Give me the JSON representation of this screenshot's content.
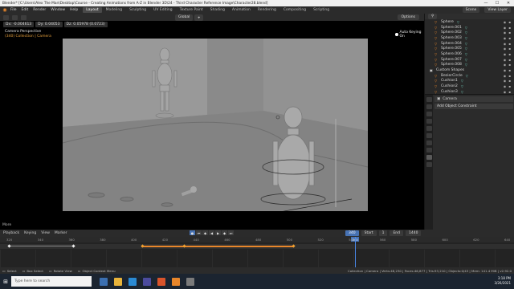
{
  "titlebar": {
    "title": "Blender* [C:\\Users\\Alex The Man\\Desktop\\Course - Creating Animations from A-Z in Blender 3D\\24 - Third Character Reference Image\\Character28.blend]",
    "minimize": "—",
    "maximize": "☐",
    "close": "✕"
  },
  "menubar": {
    "menus": [
      "File",
      "Edit",
      "Render",
      "Window",
      "Help"
    ],
    "workspaces": [
      "Layout",
      "Modeling",
      "Sculpting",
      "UV Editing",
      "Texture Paint",
      "Shading",
      "Animation",
      "Rendering",
      "Compositing",
      "Scripting"
    ],
    "active_workspace": "Layout",
    "scene": "Scene",
    "view_layer": "View Layer"
  },
  "viewport_header": {
    "orientation": "Global",
    "options": "Options"
  },
  "viewport": {
    "coords": [
      "Dx: -0.004613",
      "Dy: 0.04053",
      "Dz: 0.05978 (0.0723)"
    ],
    "info_line1": "Camera Perspective",
    "info_line2": "(340) Collection | Camera",
    "auto_keying": "Auto Keying On",
    "more": "More"
  },
  "outliner": {
    "rows": [
      {
        "label": "Sphere",
        "collection": false
      },
      {
        "label": "Sphere.001",
        "collection": false
      },
      {
        "label": "Sphere.002",
        "collection": false
      },
      {
        "label": "Sphere.003",
        "collection": false
      },
      {
        "label": "Sphere.004",
        "collection": false
      },
      {
        "label": "Sphere.005",
        "collection": false
      },
      {
        "label": "Sphere.006",
        "collection": false
      },
      {
        "label": "Sphere.007",
        "collection": false
      },
      {
        "label": "Sphere.008",
        "collection": false
      },
      {
        "label": "Custom Shapes",
        "collection": true
      },
      {
        "label": "BezierCircle",
        "collection": false
      },
      {
        "label": "Cushion1",
        "collection": false
      },
      {
        "label": "Cushion2",
        "collection": false
      },
      {
        "label": "Cushion3",
        "collection": false
      }
    ]
  },
  "properties": {
    "object": "Camera",
    "add_constraint": "Add Object Constraint"
  },
  "timeline": {
    "menus": [
      "Playback",
      "Keying",
      "View",
      "Marker"
    ],
    "current_frame": "340",
    "start_label": "Start",
    "start": "1",
    "end_label": "End",
    "end": "1440",
    "ruler": [
      "320",
      "340",
      "360",
      "380",
      "400",
      "420",
      "440",
      "460",
      "480",
      "500",
      "520",
      "540",
      "560",
      "580",
      "600",
      "620",
      "640"
    ]
  },
  "statusbar": {
    "hints": [
      "Select",
      "Box Select",
      "Rotate View",
      "Object Context Menu"
    ],
    "stats": "Collection | Camera | Verts:48,230 | Faces:46,877 | Tris:93,210 | Objects:0/43 | Mem: 141.4 MiB | v2.92.0"
  },
  "taskbar": {
    "search_placeholder": "Type here to search",
    "time": "3:18 PM",
    "date": "3/26/2021"
  },
  "colors": {
    "accent_blue": "#4772b3",
    "orange": "#e8862a",
    "teal": "#6fc7b6"
  }
}
